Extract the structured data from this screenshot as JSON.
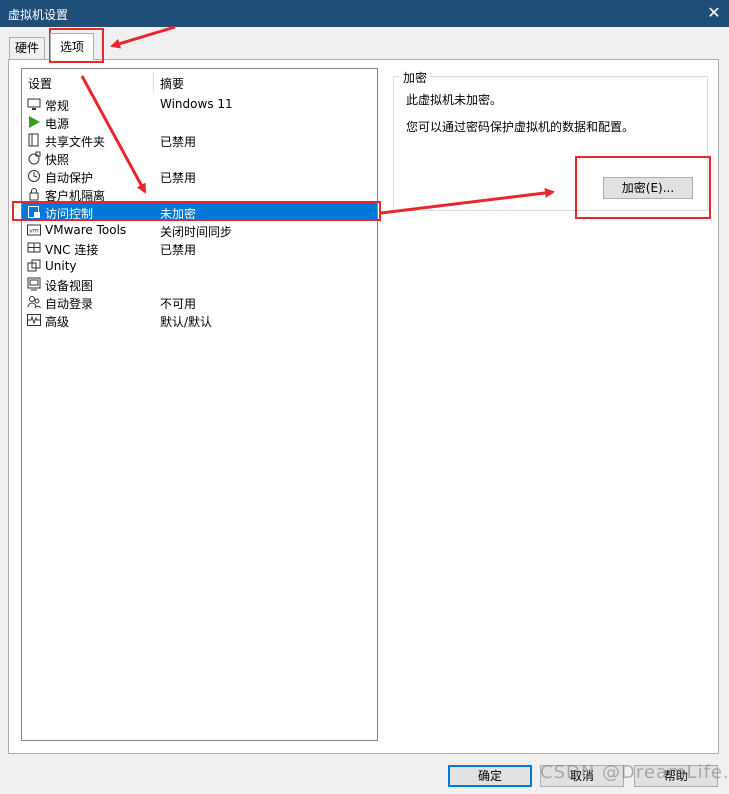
{
  "window": {
    "title": "虚拟机设置",
    "close_glyph": "✕"
  },
  "tabs": [
    {
      "label": "硬件"
    },
    {
      "label": "选项"
    }
  ],
  "list": {
    "headers": {
      "setting": "设置",
      "summary": "摘要"
    },
    "rows": [
      {
        "name": "常规",
        "summary": "Windows 11",
        "icon": "monitor-icon"
      },
      {
        "name": "电源",
        "summary": "",
        "icon": "play-icon"
      },
      {
        "name": "共享文件夹",
        "summary": "已禁用",
        "icon": "shared-folder-icon"
      },
      {
        "name": "快照",
        "summary": "",
        "icon": "snapshot-icon"
      },
      {
        "name": "自动保护",
        "summary": "已禁用",
        "icon": "clock-icon"
      },
      {
        "name": "客户机隔离",
        "summary": "",
        "icon": "lock-icon"
      },
      {
        "name": "访问控制",
        "summary": "未加密",
        "icon": "access-control-icon",
        "selected": true
      },
      {
        "name": "VMware Tools",
        "summary": "关闭时间同步",
        "icon": "vm-icon"
      },
      {
        "name": "VNC 连接",
        "summary": "已禁用",
        "icon": "vnc-icon"
      },
      {
        "name": "Unity",
        "summary": "",
        "icon": "unity-icon"
      },
      {
        "name": "设备视图",
        "summary": "",
        "icon": "device-view-icon"
      },
      {
        "name": "自动登录",
        "summary": "不可用",
        "icon": "users-icon"
      },
      {
        "name": "高级",
        "summary": "默认/默认",
        "icon": "waveform-icon"
      }
    ]
  },
  "encryption": {
    "group_title": "加密",
    "status": "此虚拟机未加密。",
    "description": "您可以通过密码保护虚拟机的数据和配置。",
    "button": "加密(E)..."
  },
  "footer": {
    "ok": "确定",
    "cancel": "取消",
    "help": "帮助"
  },
  "watermark": "CSDN @DreamLife.",
  "colors": {
    "titlebar": "#1f4e79",
    "selection": "#0078d7",
    "annotation": "#e8262b"
  }
}
